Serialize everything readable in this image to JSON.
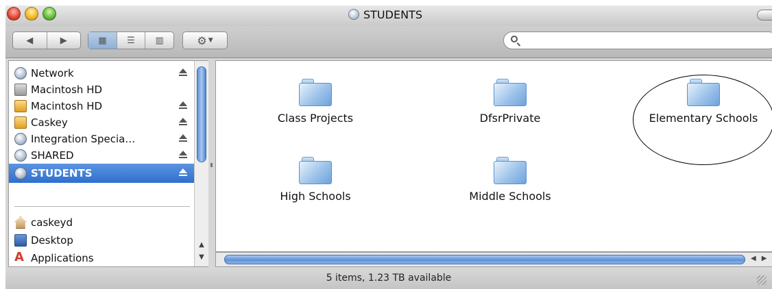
{
  "window": {
    "title": "STUDENTS"
  },
  "toolbar": {
    "back_icon": "back-arrow-icon",
    "forward_icon": "forward-arrow-icon",
    "view_icons": [
      "icon-view-icon",
      "list-view-icon",
      "column-view-icon"
    ],
    "action_icon": "gear-icon",
    "search": {
      "placeholder": "",
      "value": ""
    }
  },
  "sidebar": {
    "devices": [
      {
        "label": "Network",
        "icon": "network-globe-icon",
        "eject": true
      },
      {
        "label": "Macintosh HD",
        "icon": "hard-drive-icon",
        "eject": false
      },
      {
        "label": "Macintosh HD",
        "icon": "external-drive-icon",
        "eject": true
      },
      {
        "label": "Caskey",
        "icon": "external-drive-icon",
        "eject": true
      },
      {
        "label": "Integration Specia…",
        "icon": "network-globe-icon",
        "eject": true
      },
      {
        "label": "SHARED",
        "icon": "network-globe-icon",
        "eject": true
      },
      {
        "label": "STUDENTS",
        "icon": "network-globe-icon",
        "eject": true,
        "selected": true
      }
    ],
    "places": [
      {
        "label": "caskeyd",
        "icon": "home-icon"
      },
      {
        "label": "Desktop",
        "icon": "desktop-icon"
      },
      {
        "label": "Applications",
        "icon": "applications-icon"
      }
    ]
  },
  "content": {
    "folders": [
      {
        "label": "Class Projects"
      },
      {
        "label": "DfsrPrivate"
      },
      {
        "label": "Elementary Schools",
        "highlighted": true
      },
      {
        "label": "High Schools"
      },
      {
        "label": "Middle Schools"
      }
    ]
  },
  "status": {
    "text": "5 items, 1.23 TB available"
  },
  "colors": {
    "selection": "#3a7bd5",
    "folder": "#9dc3ea"
  }
}
